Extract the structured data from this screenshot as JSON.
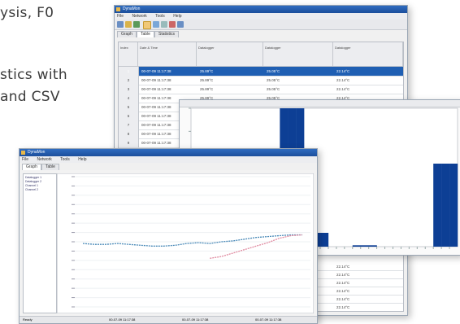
{
  "promo_lines": [
    "ysis, F0",
    "stics with",
    "and CSV"
  ],
  "table_window": {
    "title": "DynaMon",
    "menu": [
      "File",
      "Network",
      "Tools",
      "Help"
    ],
    "tabs": [
      "Graph",
      "Table",
      "Statistics"
    ],
    "active_tab": "Table",
    "columns": [
      "Index",
      "Date & Time",
      "Datalogger",
      "Datalogger",
      "Datalogger"
    ],
    "rows": [
      {
        "index": "1",
        "datetime": "00-07-09 11:17:38",
        "v1": "25.89°C",
        "v2": "25.05°C",
        "v3": "22.14°C",
        "selected": true
      },
      {
        "index": "2",
        "datetime": "00-07-09 11:17:38",
        "v1": "25.89°C",
        "v2": "25.05°C",
        "v3": "22.14°C"
      },
      {
        "index": "3",
        "datetime": "00-07-09 11:17:38",
        "v1": "25.89°C",
        "v2": "25.05°C",
        "v3": "22.14°C"
      },
      {
        "index": "4",
        "datetime": "00-07-09 11:17:38",
        "v1": "25.89°C",
        "v2": "25.05°C",
        "v3": "22.14°C"
      },
      {
        "index": "5",
        "datetime": "00-07-09 11:17:38",
        "v1": "",
        "v2": "",
        "v3": ""
      },
      {
        "index": "6",
        "datetime": "00-07-09 11:17:38",
        "v1": "",
        "v2": "",
        "v3": ""
      },
      {
        "index": "7",
        "datetime": "00-07-09 11:17:38",
        "v1": "",
        "v2": "",
        "v3": ""
      },
      {
        "index": "8",
        "datetime": "00-07-09 11:17:38",
        "v1": "",
        "v2": "",
        "v3": ""
      },
      {
        "index": "9",
        "datetime": "00-07-09 11:17:38",
        "v1": "",
        "v2": "",
        "v3": ""
      }
    ],
    "bottom_values": [
      "22.14°C",
      "22.14°C",
      "22.14°C",
      "22.14°C",
      "22.14°C",
      "22.14°C",
      "22.14°C"
    ],
    "accent_color": "#1f5fb3"
  },
  "hist_window": {
    "bar_color": "#0d3f95"
  },
  "chart_data": [
    {
      "type": "bar",
      "categories": [
        "1",
        "2",
        "3",
        "4",
        "5",
        "6",
        "7",
        "8",
        "9",
        "10",
        "11",
        "12",
        "13",
        "14",
        "15",
        "16",
        "17",
        "18",
        "19",
        "20",
        "21",
        "22",
        "23",
        "24",
        "25",
        "26",
        "27",
        "28",
        "29",
        "30",
        "31",
        "32",
        "33"
      ],
      "values": [
        0,
        0,
        0,
        0,
        0,
        0,
        0,
        0,
        1,
        1,
        2,
        30,
        30,
        30,
        3,
        3,
        3,
        0,
        0,
        0,
        0.3,
        0.3,
        0.3,
        0,
        0,
        0,
        0,
        0,
        0,
        0,
        18,
        18,
        18
      ],
      "ylim": [
        0,
        30
      ],
      "grid": false
    },
    {
      "type": "line",
      "series": [
        {
          "color": "#4a8ab8",
          "values": [
            22.3,
            22.2,
            22.2,
            22.3,
            22.2,
            22.1,
            22.0,
            22.0,
            22.1,
            22.3,
            22.4,
            22.3,
            22.5,
            22.6,
            22.8,
            23.0,
            23.1,
            23.2,
            23.3,
            23.3
          ]
        },
        {
          "color": "#e08aa0",
          "values": [
            null,
            null,
            null,
            null,
            null,
            null,
            null,
            null,
            null,
            null,
            null,
            20.6,
            20.8,
            21.2,
            21.6,
            22.0,
            22.4,
            22.9,
            23.2,
            23.3
          ]
        }
      ],
      "ylim": [
        15,
        30
      ],
      "grid": true
    }
  ],
  "line_window": {
    "title": "DynaMon",
    "menu": [
      "File",
      "Network",
      "Tools",
      "Help"
    ],
    "tabs": [
      "Graph",
      "Table"
    ],
    "tree": [
      "Datalogger 1",
      "Datalogger 2",
      "Channel 1",
      "Channel 2"
    ],
    "status": [
      "Ready",
      "00-07-09 11:17:38",
      "00-07-09 11:17:38",
      "00-07-09 11:17:38"
    ]
  }
}
